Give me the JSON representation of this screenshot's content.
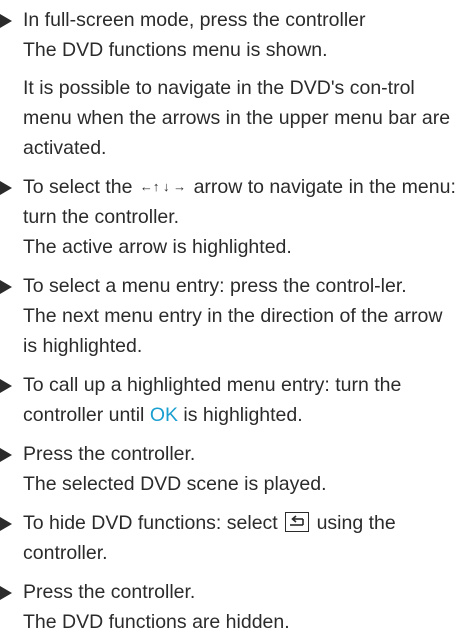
{
  "steps": [
    {
      "instruction": "In full-screen mode, press the controller",
      "result": "The DVD functions menu is shown."
    },
    {
      "note": "It is possible to navigate in the DVD's con-trol menu when the arrows in the upper menu bar are activated."
    },
    {
      "instruction_pre": "To select the",
      "arrow_glyphs": "←↑ ↓ →",
      "instruction_post": "arrow to navigate in the menu: turn the controller.",
      "result": "The active arrow is highlighted."
    },
    {
      "instruction": "To select a menu entry: press the control-ler.",
      "result": "The next menu entry in the direction of the arrow is highlighted."
    },
    {
      "instruction_pre": "To call up a highlighted menu entry: turn the controller until",
      "ok_label": "OK",
      "instruction_post": "is highlighted."
    },
    {
      "instruction": "Press the controller.",
      "result": "The selected DVD scene is played."
    },
    {
      "instruction_pre": "To hide DVD functions: select",
      "back_icon": "back-arrow-icon",
      "instruction_post": "using the controller."
    },
    {
      "instruction": "Press the controller.",
      "result": "The DVD functions are hidden."
    }
  ],
  "colors": {
    "text": "#2b2b2b",
    "ok_highlight": "#1a9fd0"
  }
}
